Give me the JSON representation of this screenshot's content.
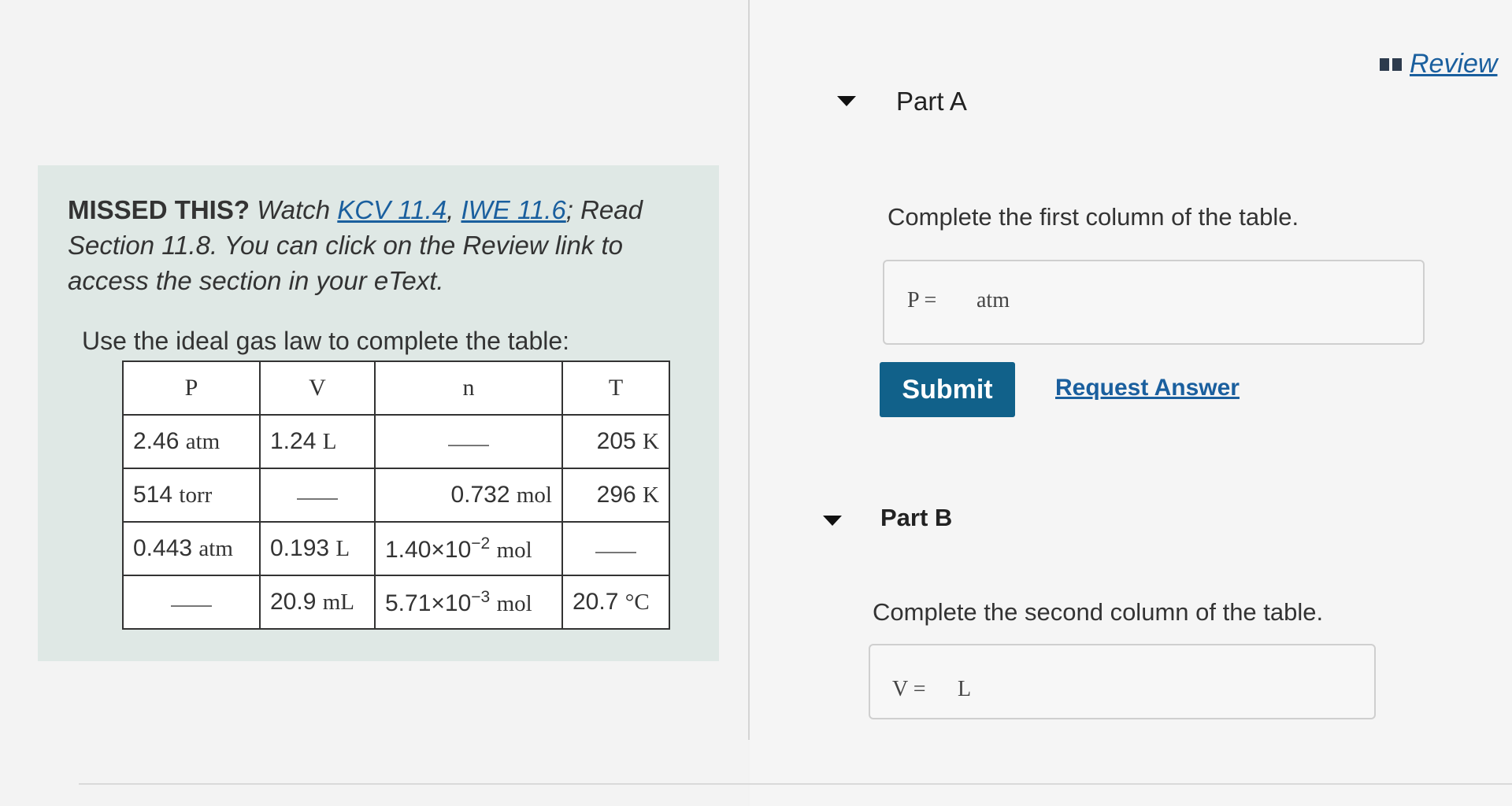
{
  "review": {
    "label": "Review",
    "icon": "book-icon"
  },
  "intro": {
    "missed": "MISSED THIS?",
    "watch": " Watch ",
    "link_kcv": "KCV 11.4",
    "comma": ", ",
    "link_iwe": "IWE 11.6",
    "read_rest": "; Read Section 11.8. You can click on the Review link to access the section in your eText.",
    "instruction": "Use the ideal gas law to complete the table:"
  },
  "table": {
    "headers": [
      "P",
      "V",
      "n",
      "T"
    ],
    "rows": [
      {
        "p_num": "2.46",
        "p_unit": "atm",
        "v_num": "1.24",
        "v_unit": "L",
        "n_num": "",
        "n_unit": "",
        "t_num": "205",
        "t_unit": "K"
      },
      {
        "p_num": "514",
        "p_unit": "torr",
        "v_num": "",
        "v_unit": "",
        "n_num": "0.732",
        "n_unit": "mol",
        "t_num": "296",
        "t_unit": "K"
      },
      {
        "p_num": "0.443",
        "p_unit": "atm",
        "v_num": "0.193",
        "v_unit": "L",
        "n_num": "1.40×10",
        "n_exp": "−2",
        "n_unit": "mol",
        "t_num": "",
        "t_unit": ""
      },
      {
        "p_num": "",
        "p_unit": "",
        "v_num": "20.9",
        "v_unit": "mL",
        "n_num": "5.71×10",
        "n_exp": "−3",
        "n_unit": "mol",
        "t_num": "20.7",
        "t_unit": "°C"
      }
    ]
  },
  "part_a": {
    "title": "Part A",
    "prompt": "Complete the first column of the table.",
    "label": "P =",
    "value": "",
    "unit": "atm",
    "submit_label": "Submit",
    "request_label": "Request Answer"
  },
  "part_b": {
    "title": "Part B",
    "prompt": "Complete the second column of the table.",
    "label": "V =",
    "value": "",
    "unit": "L"
  }
}
